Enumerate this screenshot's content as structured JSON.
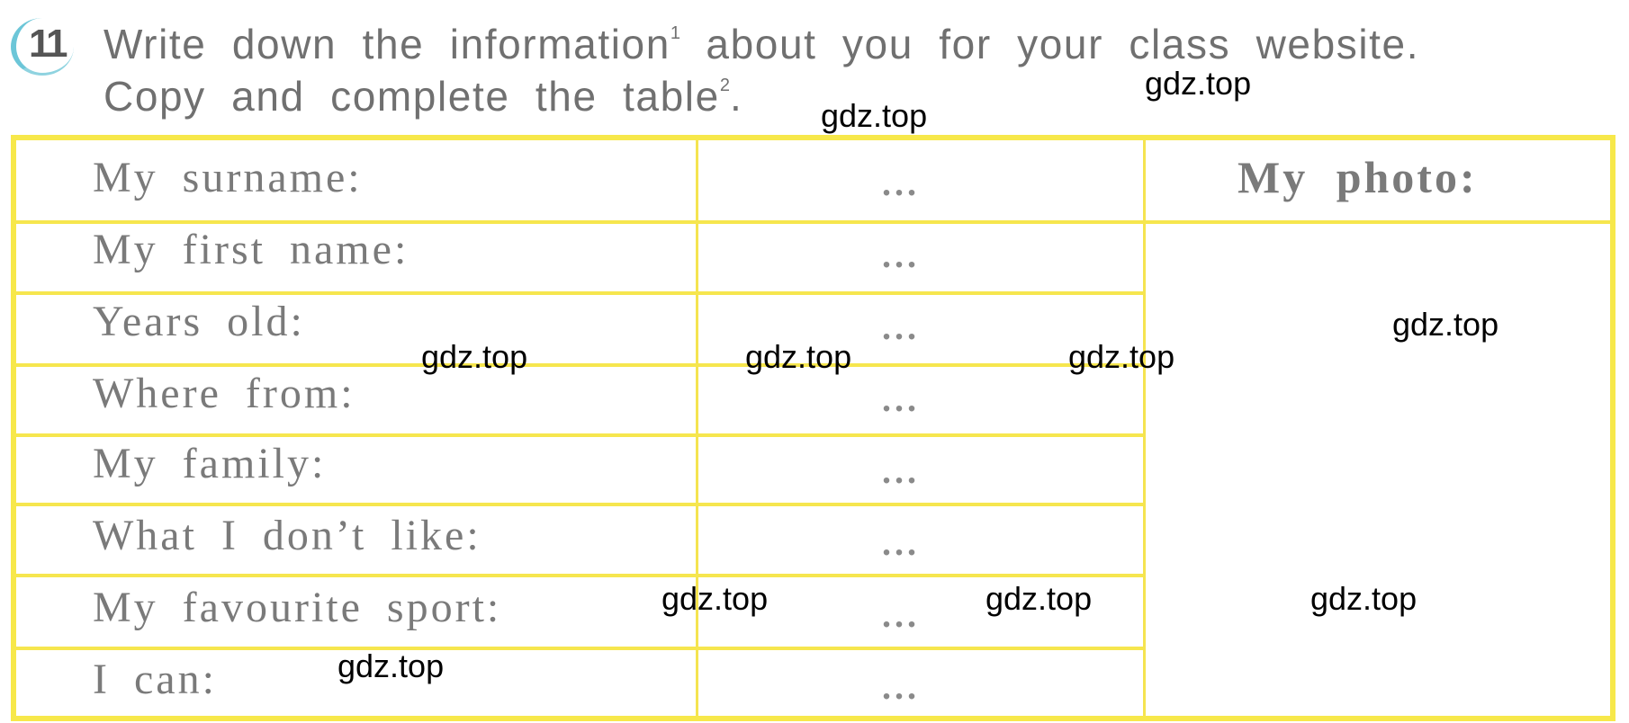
{
  "exercise": {
    "number": "11",
    "instruction_line1": "Write down the information",
    "footnote1": "1",
    "instruction_line1_rest": "about you for your class website.",
    "instruction_line2": "Copy and complete the table",
    "footnote2": "2",
    "instruction_line2_end": "."
  },
  "table": {
    "photo_header": "My photo:",
    "rows": [
      {
        "label": "My surname:",
        "value": "..."
      },
      {
        "label": "My first name:",
        "value": "..."
      },
      {
        "label": "Years old:",
        "value": "..."
      },
      {
        "label": "Where from:",
        "value": "..."
      },
      {
        "label": "My family:",
        "value": "..."
      },
      {
        "label": "What I don’t like:",
        "value": "..."
      },
      {
        "label": "My favourite sport:",
        "value": "..."
      },
      {
        "label": "I can:",
        "value": "..."
      }
    ],
    "border_color": "#f7e84a"
  },
  "watermarks": [
    "gdz.top",
    "gdz.top",
    "gdz.top",
    "gdz.top",
    "gdz.top",
    "gdz.top",
    "gdz.top",
    "gdz.top",
    "gdz.top",
    "gdz.top"
  ]
}
